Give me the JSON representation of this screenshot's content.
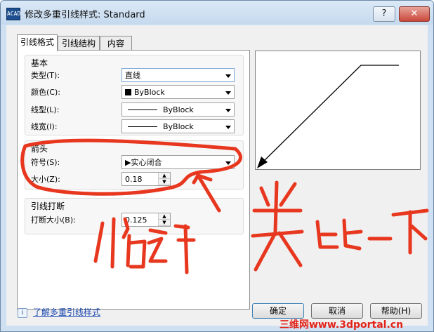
{
  "window": {
    "title": "修改多重引线样式: Standard",
    "app_icon_text": "ACAD",
    "help_button": "?",
    "close_button": "✕"
  },
  "tabs": [
    {
      "label": "引线格式",
      "active": true
    },
    {
      "label": "引线结构",
      "active": false
    },
    {
      "label": "内容",
      "active": false
    }
  ],
  "basic": {
    "title": "基本",
    "type_label": "类型(T):",
    "type_value": "直线",
    "color_label": "颜色(C):",
    "color_value": "ByBlock",
    "linetype_label": "线型(L):",
    "linetype_value": "ByBlock",
    "lineweight_label": "线宽(I):",
    "lineweight_value": "ByBlock"
  },
  "arrowhead": {
    "title": "箭头",
    "symbol_label": "符号(S):",
    "symbol_value": "实心闭合",
    "size_label": "大小(Z):",
    "size_value": "0.18"
  },
  "break": {
    "title": "引线打断",
    "size_label": "打断大小(B):",
    "size_value": "0.125"
  },
  "footer": {
    "info_icon": "i",
    "link": "了解多重引线样式",
    "ok": "确定",
    "cancel": "取消",
    "help": "帮助(H)"
  },
  "watermark": "三维网www.3dportal.cn",
  "colors": {
    "annotation_red": "#e8371f",
    "title_bg": "#cfe0f2",
    "link_blue": "#1b48b0"
  }
}
